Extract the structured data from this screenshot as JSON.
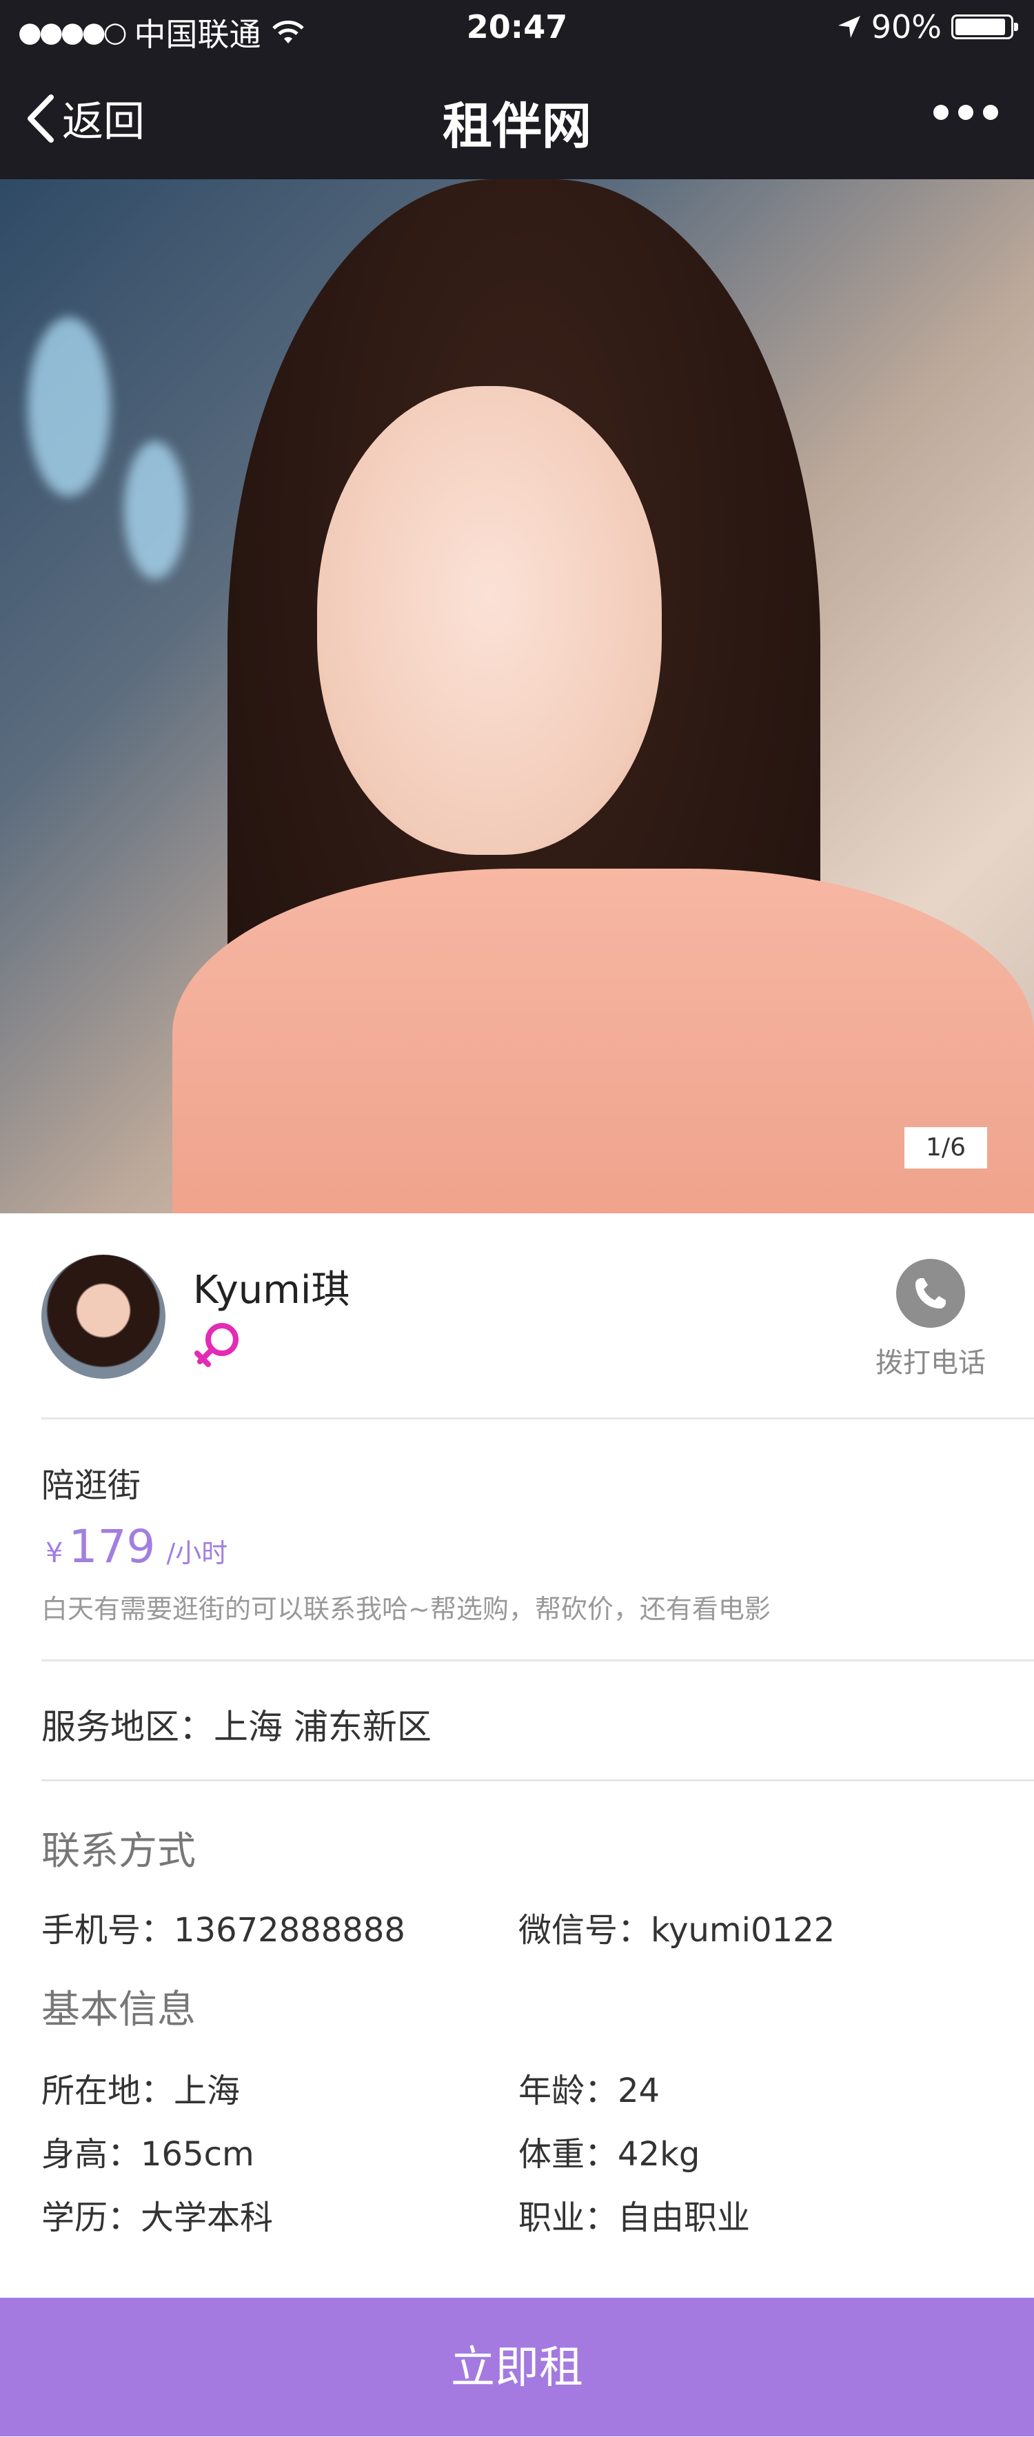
{
  "status_bar": {
    "signal_dots": "●●●●○",
    "carrier": "中国联通",
    "time": "20:47",
    "battery_text": "90%",
    "battery_level": 0.9
  },
  "nav": {
    "back_label": "返回",
    "title": "租伴网"
  },
  "gallery": {
    "counter": "1/6"
  },
  "profile": {
    "name": "Kyumi琪",
    "gender_icon": "female-symbol",
    "call_label": "拨打电话",
    "accent_color": "#a27ee0"
  },
  "service": {
    "title": "陪逛街",
    "currency": "¥",
    "price": "179",
    "unit": "/小时",
    "description": "白天有需要逛街的可以联系我哈~帮选购，帮砍价，还有看电影"
  },
  "area": {
    "text": "服务地区：上海 浦东新区"
  },
  "contact": {
    "title": "联系方式",
    "phone": "手机号：13672888888",
    "wechat": "微信号：kyumi0122"
  },
  "basic": {
    "title": "基本信息",
    "location": "所在地：上海",
    "age": "年龄：24",
    "height": "身高：165cm",
    "weight": "体重：42kg",
    "education": "学历：大学本科",
    "occupation": "职业：自由职业"
  },
  "cta": {
    "label": "立即租",
    "color": "#a47ae1"
  }
}
